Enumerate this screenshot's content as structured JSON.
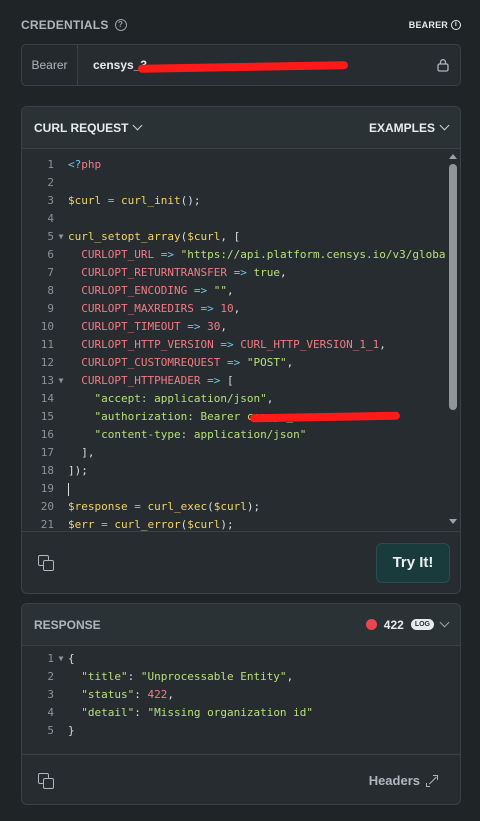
{
  "credentials": {
    "title": "CREDENTIALS",
    "auth_type": "BEARER",
    "label": "Bearer",
    "token_visible": "censys_3"
  },
  "curl": {
    "title": "CURL REQUEST",
    "examples_label": "EXAMPLES",
    "try_label": "Try It!",
    "lines": [
      {
        "n": "1",
        "text": "<?php"
      },
      {
        "n": "2",
        "text": ""
      },
      {
        "n": "3",
        "text": "$curl = curl_init();"
      },
      {
        "n": "4",
        "text": ""
      },
      {
        "n": "5",
        "text": "curl_setopt_array($curl, ["
      },
      {
        "n": "6",
        "text": "  CURLOPT_URL => \"https://api.platform.censys.io/v3/globa"
      },
      {
        "n": "7",
        "text": "  CURLOPT_RETURNTRANSFER => true,"
      },
      {
        "n": "8",
        "text": "  CURLOPT_ENCODING => \"\","
      },
      {
        "n": "9",
        "text": "  CURLOPT_MAXREDIRS => 10,"
      },
      {
        "n": "10",
        "text": "  CURLOPT_TIMEOUT => 30,"
      },
      {
        "n": "11",
        "text": "  CURLOPT_HTTP_VERSION => CURL_HTTP_VERSION_1_1,"
      },
      {
        "n": "12",
        "text": "  CURLOPT_CUSTOMREQUEST => \"POST\","
      },
      {
        "n": "13",
        "text": "  CURLOPT_HTTPHEADER => ["
      },
      {
        "n": "14",
        "text": "    \"accept: application/json\","
      },
      {
        "n": "15",
        "text": "    \"authorization: Bearer censys_"
      },
      {
        "n": "16",
        "text": "    \"content-type: application/json\""
      },
      {
        "n": "17",
        "text": "  ],"
      },
      {
        "n": "18",
        "text": "]);"
      },
      {
        "n": "19",
        "text": ""
      },
      {
        "n": "20",
        "text": "$response = curl_exec($curl);"
      },
      {
        "n": "21",
        "text": "$err = curl_error($curl);"
      }
    ]
  },
  "response": {
    "title": "RESPONSE",
    "status_code": "422",
    "log_label": "LOG",
    "headers_label": "Headers",
    "lines": [
      {
        "n": "1",
        "text": "{"
      },
      {
        "n": "2",
        "text": "  \"title\": \"Unprocessable Entity\","
      },
      {
        "n": "3",
        "text": "  \"status\": 422,"
      },
      {
        "n": "4",
        "text": "  \"detail\": \"Missing organization id\""
      },
      {
        "n": "5",
        "text": "}"
      }
    ]
  },
  "colors": {
    "background": "#1f2427",
    "error_dot": "#e8474f",
    "try_button": "#1a3b3b",
    "redaction": "#ff1a1a"
  }
}
